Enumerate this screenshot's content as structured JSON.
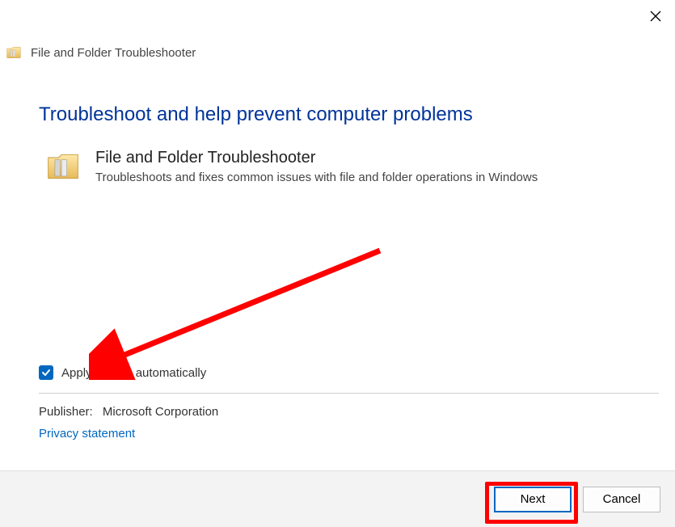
{
  "titlebar": {
    "text": "File and Folder Troubleshooter"
  },
  "heading": "Troubleshoot and help prevent computer problems",
  "tool": {
    "title": "File and Folder Troubleshooter",
    "description": "Troubleshoots and fixes common issues with file and folder operations in Windows"
  },
  "checkbox": {
    "label": "Apply repairs automatically",
    "checked": true
  },
  "publisher": {
    "label": "Publisher:",
    "value": "Microsoft Corporation"
  },
  "links": {
    "privacy": "Privacy statement"
  },
  "buttons": {
    "next": "Next",
    "cancel": "Cancel"
  },
  "colors": {
    "accent": "#0067c0",
    "highlight": "#ff0000"
  }
}
